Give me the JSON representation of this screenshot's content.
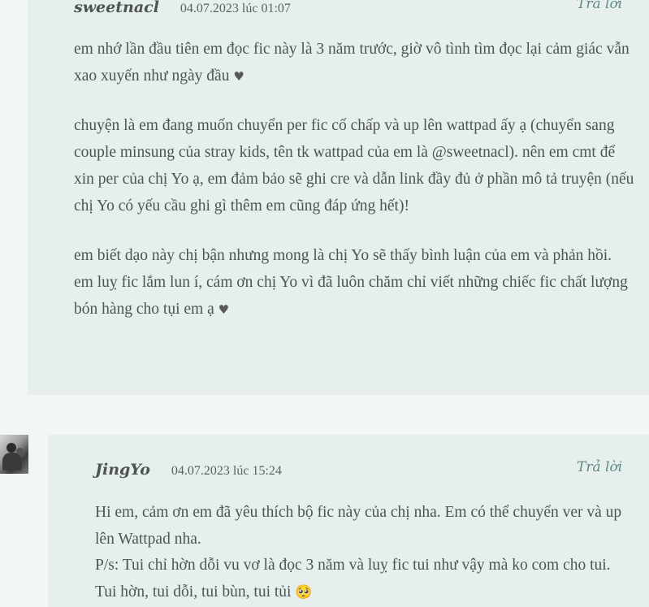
{
  "comments": [
    {
      "author": "sweetnacl",
      "date": "04.07.2023 lúc 01:07",
      "reply_label": "Trả lời",
      "paragraphs": [
        "em nhớ lần đầu tiên em đọc fic này là 3 năm trước, giờ vô tình tìm đọc lại cảm giác vẫn xao xuyến như ngày đầu",
        "chuyện là em đang muốn chuyển per fic cố chấp và up lên wattpad ấy ạ (chuyển sang couple minsung của stray kids, tên tk wattpad của em là @sweetnacl). nên em cmt để xin per của chị Yo ạ, em đảm bảo sẽ ghi cre và dẫn link đầy đủ ở phần mô tả truyện (nếu chị Yo có yếu cầu ghi gì thêm em cũng đáp ứng hết)!",
        "em biết dạo này chị bận nhưng mong là chị Yo sẽ thấy bình luận của em và phản hồi. em luỵ fic lắm lun í, cám ơn chị Yo vì đã luôn chăm chỉ viết những chiếc fic chất lượng bón hàng cho tụi em ạ"
      ],
      "heart_glyph": "♥"
    },
    {
      "author": "JingYo",
      "date": "04.07.2023 lúc 15:24",
      "reply_label": "Trả lời",
      "paragraphs": [
        "Hi em, cảm ơn em đã yêu thích bộ fic này của chị nha. Em có thể chuyển ver và up lên Wattpad nha.",
        "P/s: Tui chỉ hờn dỗi vu vơ là đọc 3 năm và luỵ fic tui như vậy mà ko com cho tui. Tui hờn, tui dỗi, tui bùn, tui tủi"
      ],
      "emoji_glyph": "🥺"
    }
  ],
  "icons": {
    "heart": "heart-icon",
    "emoji": "pleading-face-icon",
    "avatar": "avatar-image"
  },
  "colors": {
    "page_bg": "#f2f6f5",
    "card_bg": "#e7efee",
    "reply_link": "#5f8a80",
    "text": "#4d5453"
  }
}
